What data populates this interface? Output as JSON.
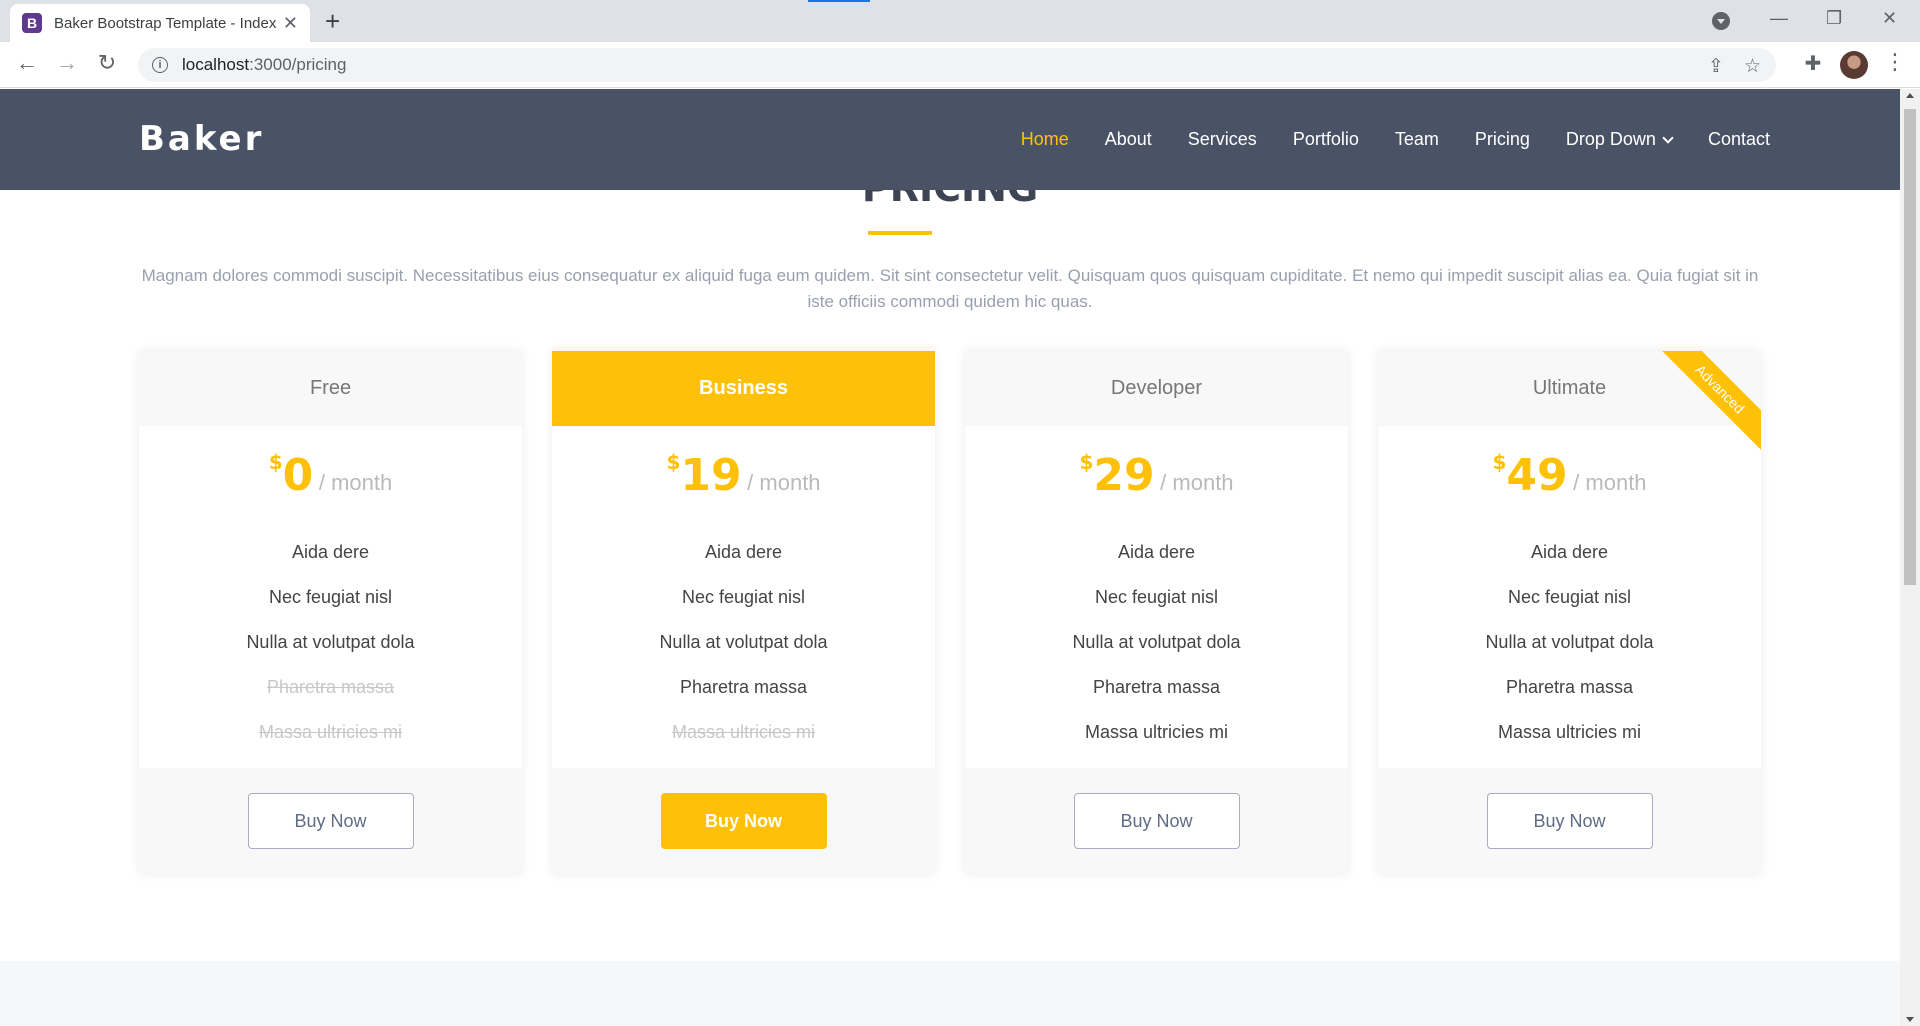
{
  "browser": {
    "tab_title": "Baker Bootstrap Template - Index",
    "tab_favicon": "B",
    "new_tab": "+",
    "url_host": "localhost",
    "url_path": ":3000/pricing"
  },
  "site": {
    "logo": "Baker",
    "menu": [
      "Home",
      "About",
      "Services",
      "Portfolio",
      "Team",
      "Pricing",
      "Drop Down",
      "Contact"
    ]
  },
  "pricing": {
    "title": "PRICING",
    "intro": "Magnam dolores commodi suscipit. Necessitatibus eius consequatur ex aliquid fuga eum quidem. Sit sint consectetur velit. Quisquam quos quisquam cupiditate. Et nemo qui impedit suscipit alias ea. Quia fugiat sit in iste officiis commodi quidem hic quas.",
    "currency": "$",
    "period": "/ month",
    "plans": [
      {
        "name": "Free",
        "price": "0",
        "features": [
          "Aida dere",
          "Nec feugiat nisl",
          "Nulla at volutpat dola",
          "Pharetra massa",
          "Massa ultricies mi"
        ],
        "button": "Buy Now"
      },
      {
        "name": "Business",
        "price": "19",
        "features": [
          "Aida dere",
          "Nec feugiat nisl",
          "Nulla at volutpat dola",
          "Pharetra massa",
          "Massa ultricies mi"
        ],
        "button": "Buy Now"
      },
      {
        "name": "Developer",
        "price": "29",
        "features": [
          "Aida dere",
          "Nec feugiat nisl",
          "Nulla at volutpat dola",
          "Pharetra massa",
          "Massa ultricies mi"
        ],
        "button": "Buy Now"
      },
      {
        "name": "Ultimate",
        "price": "49",
        "ribbon": "Advanced",
        "features": [
          "Aida dere",
          "Nec feugiat nisl",
          "Nulla at volutpat dola",
          "Pharetra massa",
          "Massa ultricies mi"
        ],
        "button": "Buy Now"
      }
    ]
  },
  "colors": {
    "accent": "#ffc107",
    "header_bg": "#4a5366"
  }
}
